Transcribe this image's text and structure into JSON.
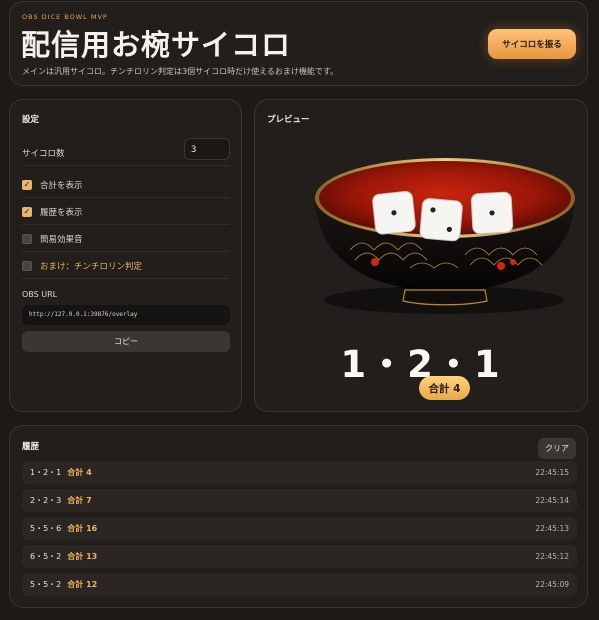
{
  "header": {
    "eyebrow": "OBS DICE BOWL MVP",
    "title": "配信用お椀サイコロ",
    "subtitle": "メインは汎用サイコロ。チンチロリン判定は3個サイコロ時だけ使えるおまけ機能です。",
    "roll_label": "サイコロを振る"
  },
  "settings": {
    "title": "設定",
    "dice_count_label": "サイコロ数",
    "dice_count_value": "3",
    "options": [
      {
        "label": "合計を表示",
        "checked": true
      },
      {
        "label": "履歴を表示",
        "checked": true
      },
      {
        "label": "簡易効果音",
        "checked": false
      },
      {
        "label": "おまけ：チンチロリン判定",
        "checked": false
      }
    ],
    "obs_url_label": "OBS URL",
    "obs_url": "http://127.0.0.1:39876/overlay",
    "copy_label": "コピー"
  },
  "preview": {
    "title": "プレビュー",
    "dice": [
      1,
      2,
      1
    ],
    "result_text": "1・2・1",
    "total_text": "合計 4"
  },
  "history": {
    "title": "履歴",
    "clear_label": "クリア",
    "rows": [
      {
        "dice": "1・2・1",
        "total": "合計 4",
        "time": "22:45:15"
      },
      {
        "dice": "2・2・3",
        "total": "合計 7",
        "time": "22:45:14"
      },
      {
        "dice": "5・5・6",
        "total": "合計 16",
        "time": "22:45:13"
      },
      {
        "dice": "6・5・2",
        "total": "合計 13",
        "time": "22:45:12"
      },
      {
        "dice": "5・5・2",
        "total": "合計 12",
        "time": "22:45:09"
      }
    ]
  },
  "colors": {
    "accent": "#e9a24c",
    "background": "#1c1917",
    "panel": "#221e1b",
    "bowl_red": "#b01a0c",
    "bowl_black": "#0d0b0a",
    "gold": "#d4a44a"
  }
}
